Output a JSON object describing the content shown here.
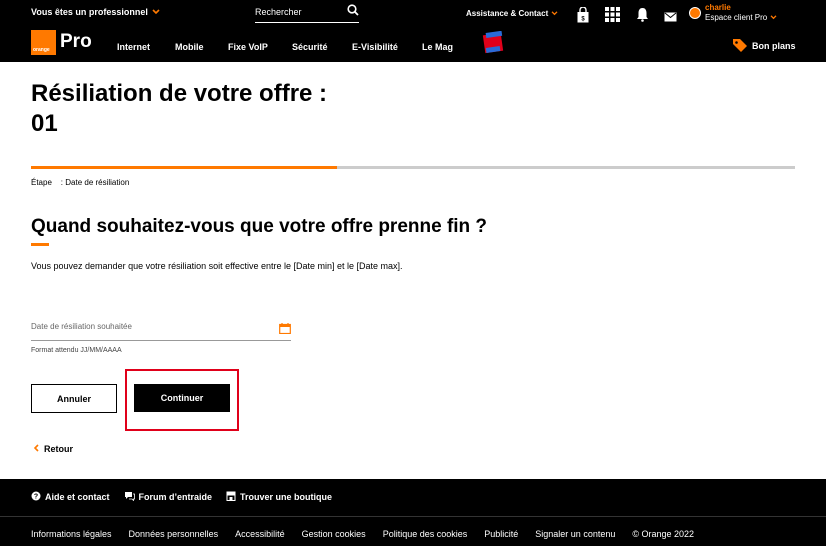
{
  "header": {
    "pro_toggle": "Vous êtes un professionnel",
    "search_placeholder": "Rechercher",
    "assistance": "Assistance & Contact",
    "user_name": "charlie",
    "espace_label": "Espace client Pro",
    "logo_text": "orange",
    "brand_suffix": "Pro",
    "nav": [
      "Internet",
      "Mobile",
      "Fixe VoIP",
      "Sécurité",
      "E-Visibilité",
      "Le Mag"
    ],
    "bon_plans": "Bon plans"
  },
  "main": {
    "title_line1": "Résiliation de votre offre :",
    "title_line2": "01",
    "progress": 0.4,
    "step_label": "Étape",
    "step_value": ": Date de résiliation",
    "question": "Quand souhaitez-vous que votre offre prenne fin ?",
    "description": "Vous pouvez demander que votre résiliation soit effective entre le [Date min] et le [Date max].",
    "date_placeholder": "Date de résiliation souhaitée",
    "format_hint": "Format attendu JJ/MM/AAAA",
    "cancel_label": "Annuler",
    "continue_label": "Continuer",
    "back_label": "Retour"
  },
  "footer": {
    "top": [
      "Aide et contact",
      "Forum d’entraide",
      "Trouver une boutique"
    ],
    "links": [
      "Informations légales",
      "Données personnelles",
      "Accessibilité",
      "Gestion cookies",
      "Politique des cookies",
      "Publicité",
      "Signaler un contenu",
      "© Orange 2022"
    ]
  },
  "colors": {
    "accent": "#ff7900",
    "highlight": "#e0001a"
  },
  "icons": [
    "chevron-down-icon",
    "search-icon",
    "basket-icon",
    "grid-icon",
    "bell-icon",
    "mail-icon",
    "tag-icon",
    "calendar-icon",
    "chevron-left-icon",
    "help-icon",
    "chat-icon",
    "shop-icon"
  ]
}
